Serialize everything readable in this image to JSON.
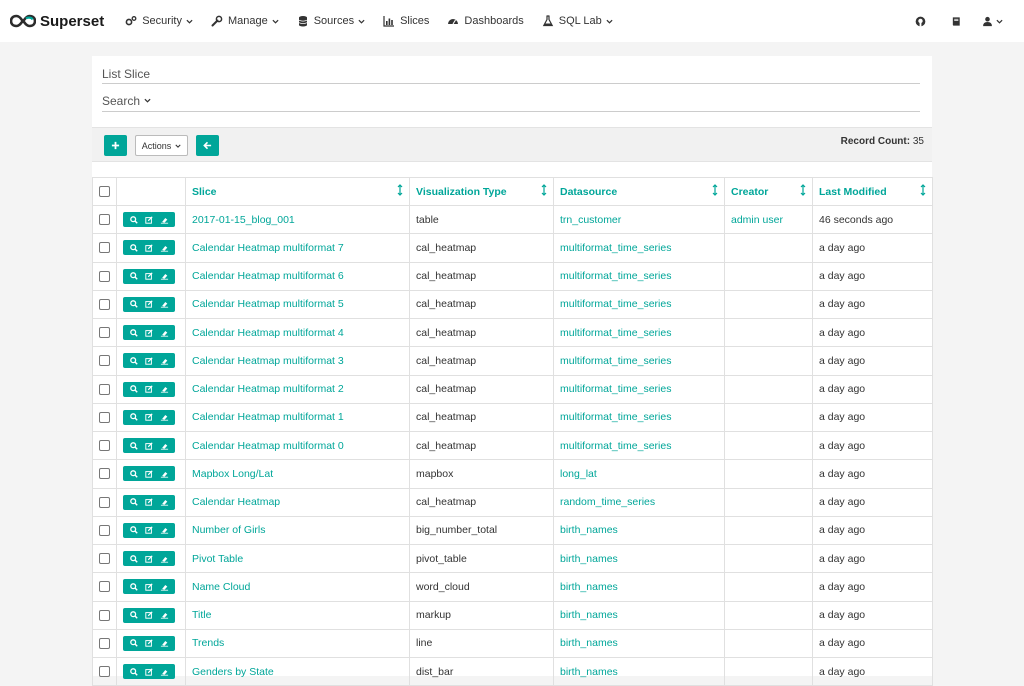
{
  "brand": {
    "name": "Superset"
  },
  "nav": {
    "items": [
      {
        "label": "Security",
        "icon": "gears-icon",
        "dropdown": true
      },
      {
        "label": "Manage",
        "icon": "wrench-icon",
        "dropdown": true
      },
      {
        "label": "Sources",
        "icon": "database-icon",
        "dropdown": true
      },
      {
        "label": "Slices",
        "icon": "bar-chart-icon",
        "dropdown": false
      },
      {
        "label": "Dashboards",
        "icon": "dashboard-icon",
        "dropdown": false
      },
      {
        "label": "SQL Lab",
        "icon": "flask-icon",
        "dropdown": true
      }
    ],
    "right_icons": [
      "github-icon",
      "book-icon",
      "user-icon"
    ]
  },
  "page": {
    "title": "List Slice",
    "search_label": "Search",
    "actions_label": "Actions",
    "record_count_label": "Record Count:",
    "record_count": "35"
  },
  "table": {
    "columns": [
      "Slice",
      "Visualization Type",
      "Datasource",
      "Creator",
      "Last Modified"
    ],
    "rows": [
      {
        "slice": "2017-01-15_blog_001",
        "viz": "table",
        "datasource": "trn_customer",
        "creator": "admin user",
        "modified": "46 seconds ago"
      },
      {
        "slice": "Calendar Heatmap multiformat 7",
        "viz": "cal_heatmap",
        "datasource": "multiformat_time_series",
        "creator": "",
        "modified": "a day ago"
      },
      {
        "slice": "Calendar Heatmap multiformat 6",
        "viz": "cal_heatmap",
        "datasource": "multiformat_time_series",
        "creator": "",
        "modified": "a day ago"
      },
      {
        "slice": "Calendar Heatmap multiformat 5",
        "viz": "cal_heatmap",
        "datasource": "multiformat_time_series",
        "creator": "",
        "modified": "a day ago"
      },
      {
        "slice": "Calendar Heatmap multiformat 4",
        "viz": "cal_heatmap",
        "datasource": "multiformat_time_series",
        "creator": "",
        "modified": "a day ago"
      },
      {
        "slice": "Calendar Heatmap multiformat 3",
        "viz": "cal_heatmap",
        "datasource": "multiformat_time_series",
        "creator": "",
        "modified": "a day ago"
      },
      {
        "slice": "Calendar Heatmap multiformat 2",
        "viz": "cal_heatmap",
        "datasource": "multiformat_time_series",
        "creator": "",
        "modified": "a day ago"
      },
      {
        "slice": "Calendar Heatmap multiformat 1",
        "viz": "cal_heatmap",
        "datasource": "multiformat_time_series",
        "creator": "",
        "modified": "a day ago"
      },
      {
        "slice": "Calendar Heatmap multiformat 0",
        "viz": "cal_heatmap",
        "datasource": "multiformat_time_series",
        "creator": "",
        "modified": "a day ago"
      },
      {
        "slice": "Mapbox Long/Lat",
        "viz": "mapbox",
        "datasource": "long_lat",
        "creator": "",
        "modified": "a day ago"
      },
      {
        "slice": "Calendar Heatmap",
        "viz": "cal_heatmap",
        "datasource": "random_time_series",
        "creator": "",
        "modified": "a day ago"
      },
      {
        "slice": "Number of Girls",
        "viz": "big_number_total",
        "datasource": "birth_names",
        "creator": "",
        "modified": "a day ago"
      },
      {
        "slice": "Pivot Table",
        "viz": "pivot_table",
        "datasource": "birth_names",
        "creator": "",
        "modified": "a day ago"
      },
      {
        "slice": "Name Cloud",
        "viz": "word_cloud",
        "datasource": "birth_names",
        "creator": "",
        "modified": "a day ago"
      },
      {
        "slice": "Title",
        "viz": "markup",
        "datasource": "birth_names",
        "creator": "",
        "modified": "a day ago"
      },
      {
        "slice": "Trends",
        "viz": "line",
        "datasource": "birth_names",
        "creator": "",
        "modified": "a day ago"
      },
      {
        "slice": "Genders by State",
        "viz": "dist_bar",
        "datasource": "birth_names",
        "creator": "",
        "modified": "a day ago"
      }
    ]
  },
  "colors": {
    "accent": "#00a699",
    "background": "#f4f4f4"
  }
}
